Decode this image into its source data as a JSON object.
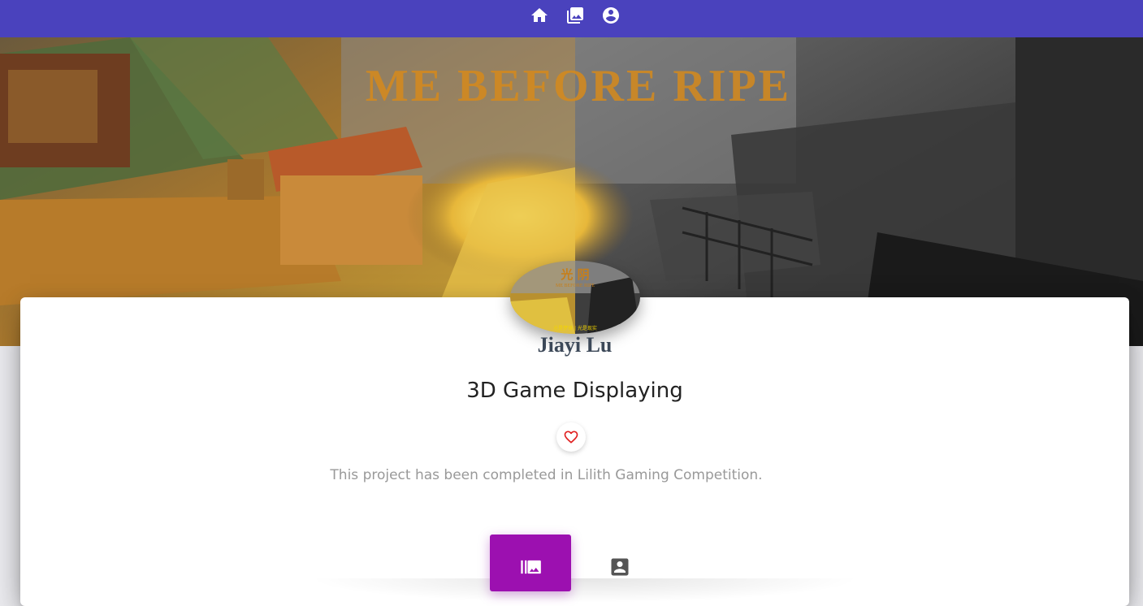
{
  "nav": {
    "items": [
      {
        "name": "home",
        "icon": "home-icon"
      },
      {
        "name": "gallery",
        "icon": "photo-library-icon"
      },
      {
        "name": "profile",
        "icon": "account-circle-icon"
      }
    ],
    "color": "#4a42bd"
  },
  "hero": {
    "banner_text": "ME BEFORE RIPE"
  },
  "avatar": {
    "logo_title": "光 阴",
    "logo_subtitle": "ME BEFORE RIPE",
    "logo_footer": "光是梦境 | 光是现实"
  },
  "author": {
    "name": "Jiayi Lu"
  },
  "project": {
    "title": "3D Game Displaying",
    "description": "This project has been completed in Lilith Gaming Competition."
  },
  "like": {
    "icon": "heart-outline-icon",
    "color": "#e01e1e"
  },
  "tabs": [
    {
      "name": "works",
      "icon": "photo-library-icon",
      "active": true
    },
    {
      "name": "about",
      "icon": "contact-card-icon",
      "active": false
    }
  ],
  "accent_color": "#9c10b0"
}
